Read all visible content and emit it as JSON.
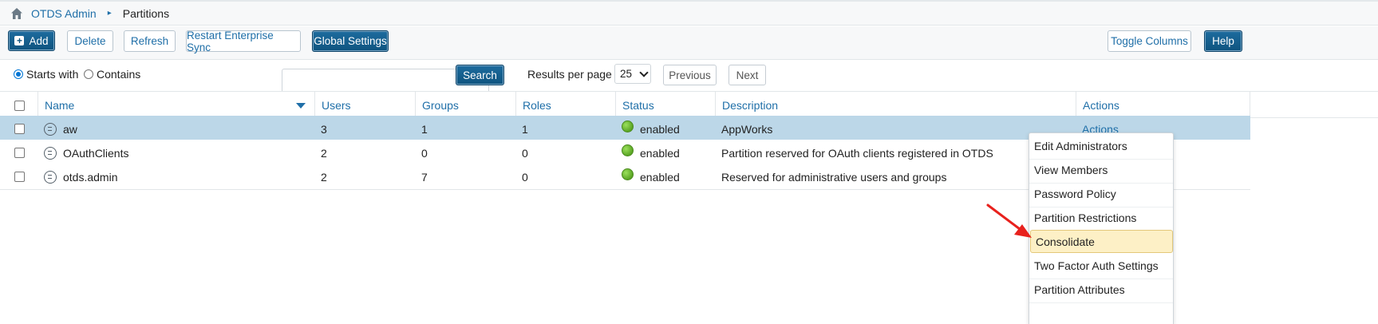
{
  "breadcrumb": {
    "root": "OTDS Admin",
    "separator": "▸",
    "current": "Partitions"
  },
  "toolbar": {
    "add": "Add",
    "delete": "Delete",
    "refresh": "Refresh",
    "restart_sync": "Restart Enterprise Sync",
    "global_settings": "Global Settings",
    "toggle_columns": "Toggle Columns",
    "help": "Help"
  },
  "search": {
    "starts_with": "Starts with",
    "contains": "Contains",
    "mode": "Starts with",
    "query": "",
    "button": "Search",
    "results_per_page_label": "Results per page",
    "results_per_page": "25",
    "previous": "Previous",
    "next": "Next"
  },
  "table": {
    "columns": {
      "name": "Name",
      "users": "Users",
      "groups": "Groups",
      "roles": "Roles",
      "status": "Status",
      "description": "Description",
      "actions": "Actions"
    },
    "rows": [
      {
        "name": "aw",
        "users": "3",
        "groups": "1",
        "roles": "1",
        "status": "enabled",
        "description": "AppWorks",
        "actions": "Actions"
      },
      {
        "name": "OAuthClients",
        "users": "2",
        "groups": "0",
        "roles": "0",
        "status": "enabled",
        "description": "Partition reserved for OAuth clients registered in OTDS",
        "actions": ""
      },
      {
        "name": "otds.admin",
        "users": "2",
        "groups": "7",
        "roles": "0",
        "status": "enabled",
        "description": "Reserved for administrative users and groups",
        "actions": ""
      }
    ]
  },
  "actions_menu": {
    "items": [
      "Edit Administrators",
      "View Members",
      "Password Policy",
      "Partition Restrictions",
      "Consolidate",
      "Two Factor Auth Settings",
      "Partition Attributes"
    ],
    "highlighted": "Consolidate"
  },
  "colors": {
    "accent": "#1f6fa8",
    "dark_button": "#0f547f",
    "selected_row": "#bcd7e8",
    "highlight": "#fdf0c6",
    "arrow": "#e8211d",
    "status_enabled": "#5aa524"
  }
}
